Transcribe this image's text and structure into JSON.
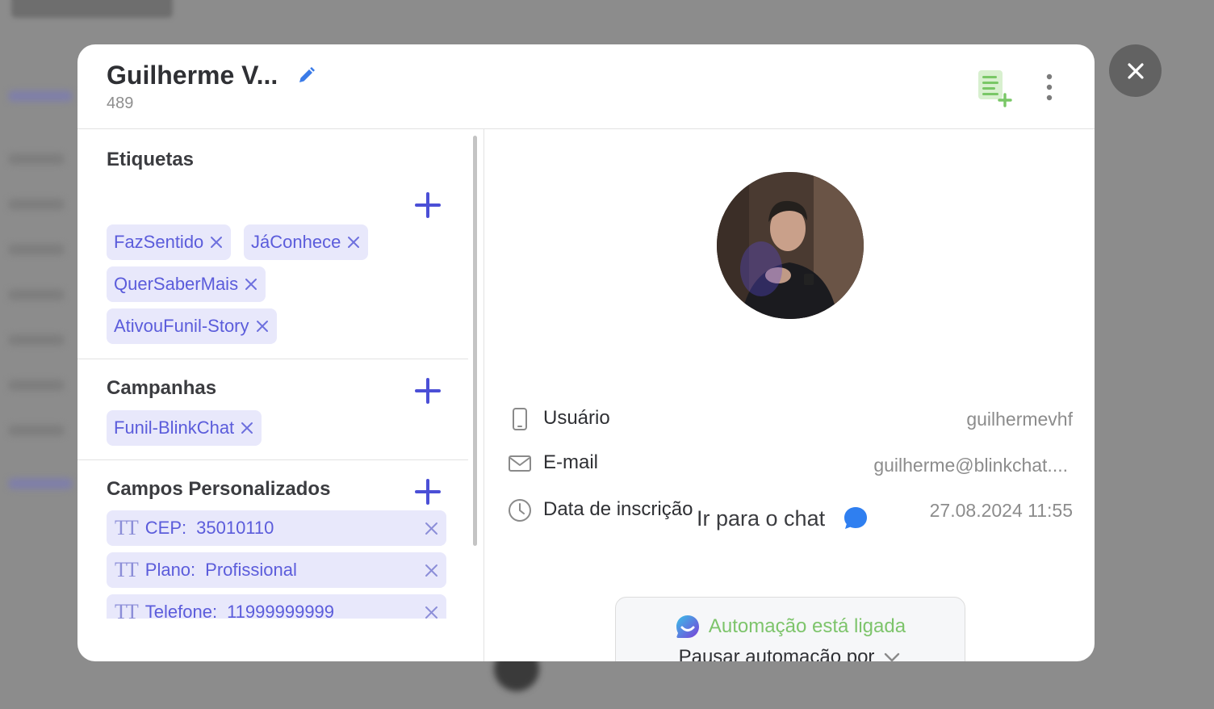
{
  "contact": {
    "name": "Guilherme V...",
    "id": "489"
  },
  "tags_section": {
    "title": "Etiquetas",
    "tags": [
      "FazSentido",
      "JáConhece",
      "QuerSaberMais",
      "AtivouFunil-Story"
    ]
  },
  "campaigns_section": {
    "title": "Campanhas",
    "tags": [
      "Funil-BlinkChat"
    ]
  },
  "custom_fields_section": {
    "title": "Campos Personalizados",
    "fields": [
      {
        "name": "CEP:",
        "value": "35010110"
      },
      {
        "name": "Plano:",
        "value": "Profissional"
      },
      {
        "name": "Telefone:",
        "value": "11999999999"
      }
    ]
  },
  "details": {
    "username_label": "Usuário",
    "username_value": "guilhermevhf",
    "email_label": "E-mail",
    "email_value": "guilherme@blinkchat....",
    "signup_label": "Data de inscrição",
    "signup_value": "27.08.2024 11:55"
  },
  "chat_link": "Ir para o chat",
  "automation": {
    "status": "Automação está ligada",
    "pause_label": "Pausar automação por"
  },
  "icons": {
    "edit": "pencil-icon",
    "note": "add-note-icon",
    "more": "more-vertical-icon",
    "close": "close-icon",
    "add": "plus-icon",
    "remove": "x-icon",
    "text_field": "text-type-icon",
    "phone": "smartphone-icon",
    "mail": "mail-icon",
    "clock": "clock-icon",
    "chat": "chat-bubble-icon",
    "chevron": "chevron-down-icon"
  },
  "colors": {
    "accent": "#4b4fd6",
    "tag_bg": "#e8e8fb",
    "tag_text": "#5b5cdb",
    "automation_on": "#7dc46b",
    "chat_blue": "#2f7ff0"
  }
}
